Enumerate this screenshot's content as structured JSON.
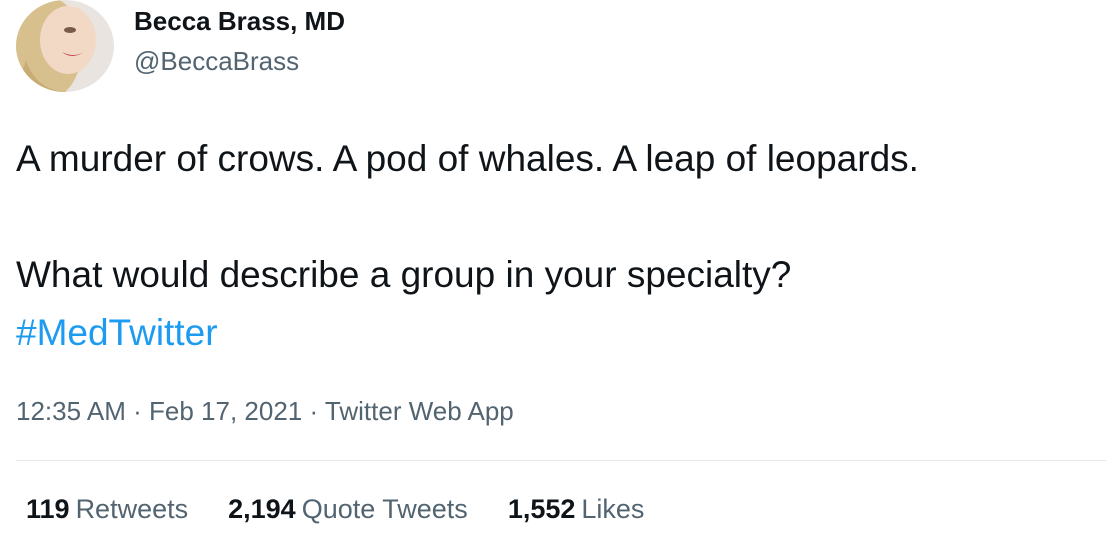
{
  "author": {
    "name": "Becca Brass, MD",
    "handle": "@BeccaBrass",
    "avatar_icon": "profile-photo"
  },
  "tweet": {
    "line1": "A murder of crows. A pod of whales. A leap of leopards.",
    "line2": "What would describe a group in your specialty?",
    "hashtag": "#MedTwitter"
  },
  "meta": {
    "time": "12:35 AM",
    "sep1": "·",
    "date": "Feb 17, 2021",
    "sep2": "·",
    "source": "Twitter Web App"
  },
  "stats": {
    "retweets_count": "119",
    "retweets_label": "Retweets",
    "quotes_count": "2,194",
    "quotes_label": "Quote Tweets",
    "likes_count": "1,552",
    "likes_label": "Likes"
  },
  "colors": {
    "text": "#0f1419",
    "secondary": "#536471",
    "link": "#1d9bf0",
    "divider": "#e6e9ec"
  }
}
